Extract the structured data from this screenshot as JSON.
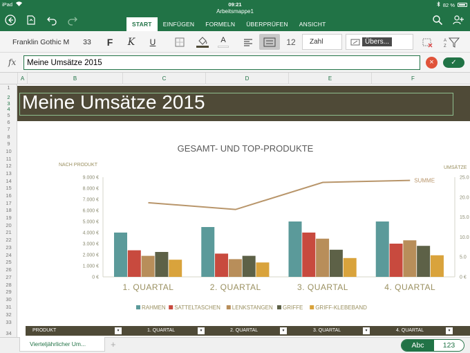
{
  "status": {
    "left": "iPad",
    "time": "09:21",
    "battery": "82 %"
  },
  "document": {
    "title": "Arbeitsmappe1"
  },
  "ribbon": {
    "tabs": [
      {
        "label": "START",
        "active": true
      },
      {
        "label": "EINFÜGEN",
        "active": false
      },
      {
        "label": "FORMELN",
        "active": false
      },
      {
        "label": "ÜBERPRÜFEN",
        "active": false
      },
      {
        "label": "ANSICHT",
        "active": false
      }
    ]
  },
  "toolbar": {
    "font_name": "Franklin Gothic M",
    "font_size": "33",
    "bold_label": "F",
    "italic_label": "K",
    "underline_label": "U",
    "decimal_label": "12",
    "number_format": "Zahl",
    "cell_style": "Übers...",
    "fill_color": "#4f4a37",
    "font_color": "#ffffff"
  },
  "formula_bar": {
    "fx_label": "fx",
    "value": "Meine Umsätze 2015",
    "confirm_label": "✓",
    "cancel_label": "×"
  },
  "grid": {
    "columns": [
      "A",
      "B",
      "C",
      "D",
      "E",
      "F"
    ],
    "rows": [
      "1",
      "2",
      "3",
      "4",
      "5",
      "6",
      "7",
      "8",
      "9",
      "10",
      "11",
      "12",
      "13",
      "14",
      "15",
      "16",
      "17",
      "18",
      "19",
      "20",
      "21",
      "22",
      "23",
      "24",
      "25",
      "26",
      "27",
      "28",
      "29",
      "30",
      "31",
      "32",
      "33",
      "34"
    ],
    "selected_rows": [
      "2",
      "3",
      "4"
    ]
  },
  "sheet": {
    "title": "Meine Umsätze 2015",
    "table_headers": [
      "PRODUKT",
      "1. QUARTAL",
      "2. QUARTAL",
      "3. QUARTAL",
      "4. QUARTAL"
    ]
  },
  "chart_data": {
    "type": "bar",
    "title": "GESAMT- UND TOP-PRODUKTE",
    "ylabel": "NACH PRODUKT",
    "y2label": "UMSÄTZE",
    "categories": [
      "1. QUARTAL",
      "2. QUARTAL",
      "3. QUARTAL",
      "4. QUARTAL"
    ],
    "ylim": [
      0,
      9000
    ],
    "y2lim": [
      0,
      25000
    ],
    "yticks": [
      "0 €",
      "1.000 €",
      "2.000 €",
      "3.000 €",
      "4.000 €",
      "5.000 €",
      "6.000 €",
      "7.000 €",
      "8.000 €",
      "9.000 €"
    ],
    "y2ticks": [
      "0 €",
      "5.0",
      "10.0",
      "15.0",
      "20.0",
      "25.0"
    ],
    "series": [
      {
        "name": "RAHMEN",
        "color": "#5b9a9a",
        "values": [
          4000,
          4500,
          5000,
          5000
        ]
      },
      {
        "name": "SATTELTASCHEN",
        "color": "#c84a3e",
        "values": [
          2400,
          2100,
          4000,
          3000
        ]
      },
      {
        "name": "LENKSTANGEN",
        "color": "#b88e5a",
        "values": [
          1900,
          1600,
          3450,
          3300
        ]
      },
      {
        "name": "GRIFFE",
        "color": "#5d6147",
        "values": [
          2250,
          1900,
          2450,
          2800
        ]
      },
      {
        "name": "GRIFF-KLEBEBAND",
        "color": "#d9a33c",
        "values": [
          1550,
          1300,
          1700,
          1950
        ]
      }
    ],
    "line_series": {
      "name": "SUMME",
      "color": "#b8956a",
      "values": [
        18600,
        16900,
        23700,
        24200
      ]
    },
    "legend": "bottom"
  },
  "sheet_tabs": {
    "active": "Vierteljährlicher Um...",
    "add_label": "+"
  },
  "keyboard_toggle": {
    "abc": "Abc",
    "num": "123"
  }
}
